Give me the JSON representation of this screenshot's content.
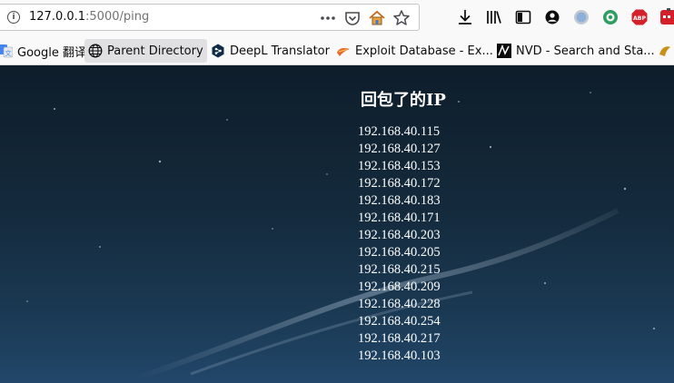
{
  "browser": {
    "url": {
      "host": "127.0.0.1",
      "path": ":5000/ping"
    },
    "bookmarks": [
      {
        "label": "Google 翻译",
        "icon": "google-translate-icon"
      },
      {
        "label": "Parent Directory",
        "icon": "globe-icon"
      },
      {
        "label": "DeepL Translator",
        "icon": "deepl-icon"
      },
      {
        "label": "Exploit Database - Ex...",
        "icon": "exploit-db-icon"
      },
      {
        "label": "NVD - Search and Sta...",
        "icon": "nvd-icon"
      }
    ],
    "toolbar_icons": [
      "download-icon",
      "library-icon",
      "sidebar-icon",
      "account-icon",
      "extension-icon",
      "extension-icon",
      "adblock-plus-icon",
      "extension-icon"
    ],
    "adblock_label": "ABP"
  },
  "page": {
    "heading": "回包了的IP",
    "ips": [
      "192.168.40.115",
      "192.168.40.127",
      "192.168.40.153",
      "192.168.40.172",
      "192.168.40.183",
      "192.168.40.171",
      "192.168.40.203",
      "192.168.40.205",
      "192.168.40.215",
      "192.168.40.209",
      "192.168.40.228",
      "192.168.40.254",
      "192.168.40.217",
      "192.168.40.103"
    ]
  },
  "colors": {
    "page_background_top": "#0e1d2a",
    "page_background_bottom": "#22476a",
    "text": "#ffffff",
    "chrome": "#f9f9fa"
  }
}
